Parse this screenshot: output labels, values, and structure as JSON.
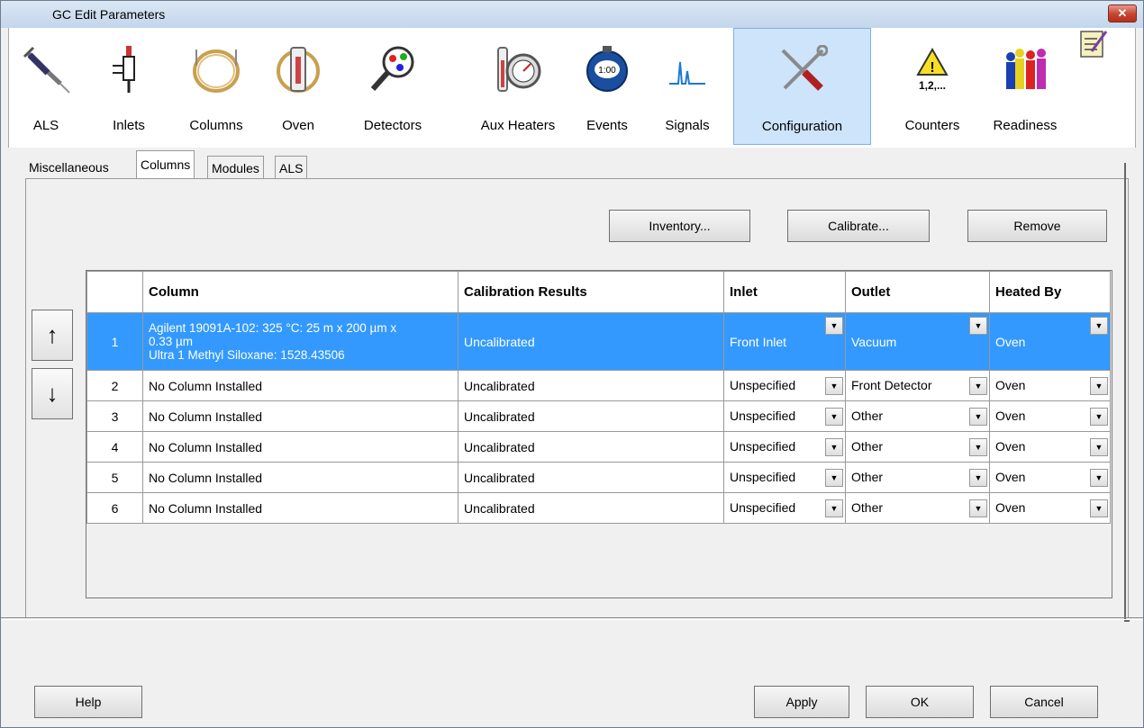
{
  "window": {
    "title": "GC Edit Parameters",
    "close_symbol": "✕"
  },
  "toolbar": {
    "items": [
      {
        "label": "ALS",
        "icon": "syringe-icon"
      },
      {
        "label": "Inlets",
        "icon": "inlet-icon"
      },
      {
        "label": "Columns",
        "icon": "column-coil-icon"
      },
      {
        "label": "Oven",
        "icon": "oven-icon"
      },
      {
        "label": "Detectors",
        "icon": "detector-magnifier-icon"
      },
      {
        "label": "Aux Heaters",
        "icon": "aux-heater-gauge-icon"
      },
      {
        "label": "Events",
        "icon": "stopwatch-icon",
        "icon_text": "1:00"
      },
      {
        "label": "Signals",
        "icon": "signal-peak-icon"
      },
      {
        "label": "Configuration",
        "icon": "wrench-screwdriver-icon",
        "active": true
      },
      {
        "label": "Counters",
        "icon": "warning-counter-icon",
        "icon_text": "1,2,..."
      },
      {
        "label": "Readiness",
        "icon": "readiness-people-icon"
      }
    ]
  },
  "tabs": [
    {
      "label": "Miscellaneous",
      "active": false
    },
    {
      "label": "Columns",
      "active": true
    },
    {
      "label": "Modules",
      "active": false
    },
    {
      "label": "ALS",
      "active": false
    }
  ],
  "actions": {
    "inventory": "Inventory...",
    "calibrate": "Calibrate...",
    "remove": "Remove"
  },
  "move": {
    "up": "↑",
    "down": "↓"
  },
  "table": {
    "headers": [
      "",
      "Column",
      "Calibration Results",
      "Inlet",
      "Outlet",
      "Heated By"
    ],
    "rows": [
      {
        "num": "1",
        "column_line1": "Agilent 19091A-102: 325 °C: 25 m x 200 µm x",
        "column_line2": "0.33 µm",
        "column_line3": "Ultra 1 Methyl Siloxane: 1528.43506",
        "calibration": "Uncalibrated",
        "inlet": "Front Inlet",
        "outlet": "Vacuum",
        "heated_by": "Oven",
        "selected": true
      },
      {
        "num": "2",
        "column": "No Column Installed",
        "calibration": "Uncalibrated",
        "inlet": "Unspecified",
        "outlet": "Front Detector",
        "heated_by": "Oven"
      },
      {
        "num": "3",
        "column": "No Column Installed",
        "calibration": "Uncalibrated",
        "inlet": "Unspecified",
        "outlet": "Other",
        "heated_by": "Oven"
      },
      {
        "num": "4",
        "column": "No Column Installed",
        "calibration": "Uncalibrated",
        "inlet": "Unspecified",
        "outlet": "Other",
        "heated_by": "Oven"
      },
      {
        "num": "5",
        "column": "No Column Installed",
        "calibration": "Uncalibrated",
        "inlet": "Unspecified",
        "outlet": "Other",
        "heated_by": "Oven"
      },
      {
        "num": "6",
        "column": "No Column Installed",
        "calibration": "Uncalibrated",
        "inlet": "Unspecified",
        "outlet": "Other",
        "heated_by": "Oven"
      }
    ]
  },
  "footer": {
    "help": "Help",
    "apply": "Apply",
    "ok": "OK",
    "cancel": "Cancel"
  },
  "colors": {
    "selection": "#3399ff",
    "title_bar": "#c3d6ec",
    "active_tool": "#cde4fb"
  }
}
